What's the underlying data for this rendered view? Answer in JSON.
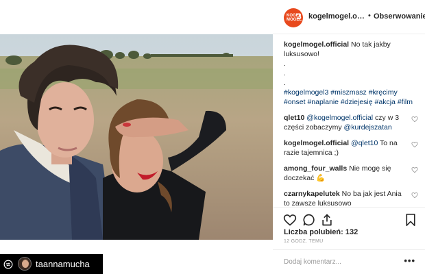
{
  "post": {
    "account": "kogelmogel.official",
    "follow_label": "Obserwowanie",
    "avatar_text": [
      "KOGEL",
      "MOGEL",
      "3"
    ],
    "caption": {
      "user": "kogelmogel.official",
      "text": "No tak jakby luksusowo!",
      "dots": [
        ".",
        ".",
        "."
      ],
      "hashtags": "#kogelmogel3 #miszmasz #kręcimy #onset #naplanie #dziejesię #akcja #film"
    },
    "comments": [
      {
        "user": "qlet10",
        "mention": "@kogelmogel.official",
        "text": " czy w 3 części zobaczymy ",
        "mention2": "@kurdejszatan"
      },
      {
        "user": "kogelmogel.official",
        "mention": "@qlet10",
        "text": " To na razie tajemnica ;)",
        "mention2": ""
      },
      {
        "user": "among_four_walls",
        "mention": "",
        "text": "Nie mogę się doczekać 💪",
        "mention2": ""
      },
      {
        "user": "czarnykapelutek",
        "mention": "",
        "text": "No ba jak jest Ania to zawsze luksusowo",
        "mention2": ""
      }
    ],
    "likes_label": "Liczba polubień: 132",
    "time_label": "12 GODZ. TEMU",
    "add_comment_placeholder": "Dodaj komentarz...",
    "more_label": "•••"
  },
  "repost_credit": {
    "username": "taannamucha"
  },
  "icons": [
    "heart-icon",
    "comment-icon",
    "share-icon",
    "bookmark-icon",
    "repost-icon"
  ],
  "colors": {
    "link": "#003569",
    "brand": "#e8491d",
    "text": "#262626",
    "muted": "#999999"
  }
}
